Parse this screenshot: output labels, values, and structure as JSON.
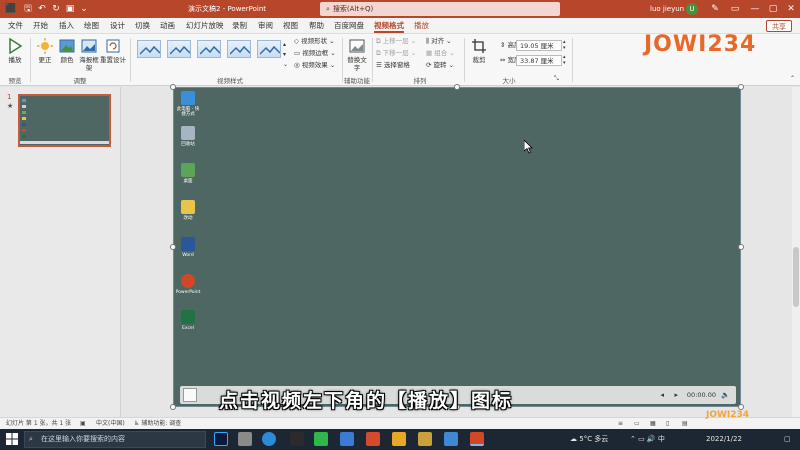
{
  "window": {
    "doc_title": "演示文稿2",
    "app_name": "PowerPoint",
    "search_placeholder": "搜索(Alt+Q)",
    "user_name": "luo jieyun",
    "user_initial": "U"
  },
  "menu": {
    "tabs": [
      {
        "label": "文件"
      },
      {
        "label": "开始"
      },
      {
        "label": "插入"
      },
      {
        "label": "绘图"
      },
      {
        "label": "设计"
      },
      {
        "label": "切换"
      },
      {
        "label": "动画"
      },
      {
        "label": "幻灯片放映"
      },
      {
        "label": "录制"
      },
      {
        "label": "审阅"
      },
      {
        "label": "视图"
      },
      {
        "label": "帮助"
      },
      {
        "label": "百度网盘"
      },
      {
        "label": "视频格式",
        "state": "active"
      },
      {
        "label": "播放",
        "state": "accent"
      }
    ],
    "share_label": "共享"
  },
  "ribbon": {
    "preview": {
      "play_label": "播放",
      "group_label": "预览"
    },
    "adjust": {
      "correct_label": "更正",
      "color_label": "颜色",
      "poster_label": "海报框架",
      "reset_label": "重置设计",
      "group_label": "调整"
    },
    "video_styles": {
      "shape_label": "视频形状",
      "border_label": "视频边框",
      "effects_label": "视频效果",
      "group_label": "视频样式"
    },
    "accessibility": {
      "alt_text_label": "替换文字",
      "group_label": "辅助功能"
    },
    "arrange": {
      "bring_forward": "上移一层",
      "send_backward": "下移一层",
      "selection_pane": "选择窗格",
      "align": "对齐",
      "group": "组合",
      "rotate": "旋转",
      "group_label": "排列"
    },
    "size": {
      "crop_label": "裁剪",
      "height_label": "高度:",
      "height_value": "19.05 厘米",
      "width_label": "宽度:",
      "width_value": "33.87 厘米",
      "group_label": "大小"
    }
  },
  "thumbnails": {
    "slide_number": "1",
    "marker": "★"
  },
  "slide": {
    "desktop_icons": [
      {
        "label": "此电脑 - 快捷方式",
        "color": "#3a8fd9"
      },
      {
        "label": "回收站",
        "color": "#a7b4c1"
      },
      {
        "label": "桌面",
        "color": "#5aa55a"
      },
      {
        "label": "改动",
        "color": "#e8c54a"
      },
      {
        "label": "Word",
        "color": "#2b579a"
      },
      {
        "label": "PowerPoint",
        "color": "#d24726"
      },
      {
        "label": "Excel",
        "color": "#217346"
      }
    ],
    "video_time": "00:00.00"
  },
  "caption": "点击视频左下角的【播放】图标",
  "status": {
    "slide_info": "幻灯片 第 1 张，共 1 张",
    "language": "中文(中国)",
    "accessibility": "辅助功能: 调查"
  },
  "taskbar": {
    "search_placeholder": "在这里输入你要搜索的内容",
    "weather": "5°C 多云",
    "date": "2022/1/22"
  },
  "watermark": {
    "logo_text": "JOWI234",
    "corner_text": "JOWI234"
  }
}
